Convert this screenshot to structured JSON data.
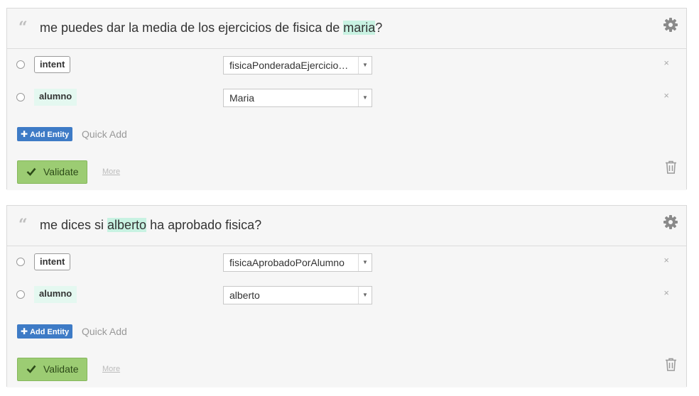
{
  "cards": [
    {
      "sentence": {
        "before": "me puedes dar la media de los ejercicios de fisica de ",
        "highlight": "maria",
        "after": "?"
      },
      "entities": [
        {
          "label": "intent",
          "value": "fisicaPonderadaEjercicio…"
        },
        {
          "label": "alumno",
          "value": "Maria"
        }
      ],
      "add_entity_label": "Add Entity",
      "quick_add_label": "Quick Add",
      "validate_label": "Validate",
      "more_label": "More"
    },
    {
      "sentence": {
        "before": "me dices si ",
        "highlight": "alberto",
        "after": " ha aprobado fisica?"
      },
      "entities": [
        {
          "label": "intent",
          "value": "fisicaAprobadoPorAlumno"
        },
        {
          "label": "alumno",
          "value": "alberto"
        }
      ],
      "add_entity_label": "Add Entity",
      "quick_add_label": "Quick Add",
      "validate_label": "Validate",
      "more_label": "More"
    }
  ],
  "colors": {
    "highlight": "#c8f2e2",
    "add_entity_button": "#3e7bc6",
    "validate_button": "#9ccc73"
  },
  "icons": [
    "quote-icon",
    "gear-icon",
    "close-icon",
    "dropdown-arrow-icon",
    "plus-icon",
    "check-icon",
    "trash-icon"
  ]
}
